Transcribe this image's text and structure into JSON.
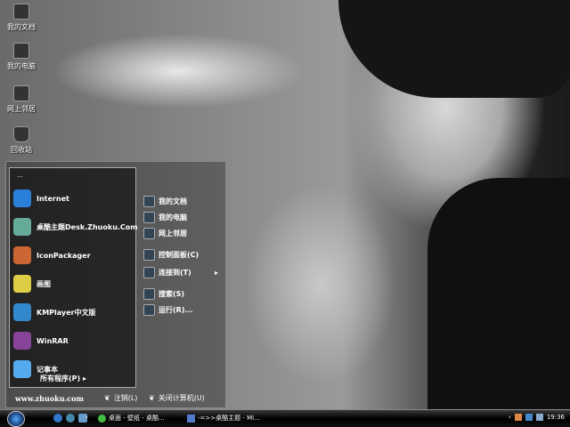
{
  "desktop": {
    "icons": [
      "我的文档",
      "我的电脑",
      "网上邻居",
      "回收站"
    ]
  },
  "start_menu": {
    "user": "...",
    "programs": [
      {
        "label": "Internet",
        "color": "#2a7fd8"
      },
      {
        "label": "桌酷主题Desk.Zhuoku.Com",
        "color": "#6a9"
      },
      {
        "label": "IconPackager",
        "color": "#c63"
      },
      {
        "label": "画图",
        "color": "#dc4"
      },
      {
        "label": "KMPlayer中文版",
        "color": "#38c"
      },
      {
        "label": "WinRAR",
        "color": "#849"
      },
      {
        "label": "记事本",
        "color": "#5ae"
      }
    ],
    "all_programs": "所有程序(P)",
    "places": [
      "我的文档",
      "我的电脑",
      "网上邻居",
      "控制面板(C)",
      "连接到(T)",
      "搜索(S)",
      "运行(R)..."
    ],
    "website": "www.zhuoku.com",
    "logoff": "注销(L)",
    "shutdown": "关闭计算机(U)"
  },
  "taskbar": {
    "tasks": [
      "桌面 - 壁纸 - 桌酷...",
      "-=>>桌酷主题 - Mi..."
    ],
    "clock": "19:36",
    "chevron": "›"
  }
}
